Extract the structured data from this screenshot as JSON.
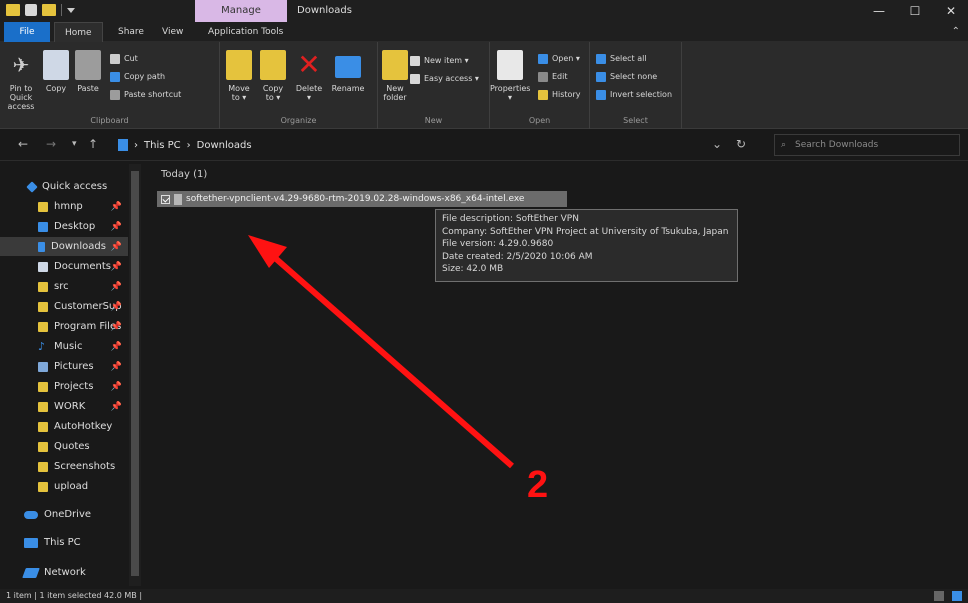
{
  "titlebar": {
    "manage_tab": "Manage",
    "title": "Downloads",
    "minimize": "—",
    "maximize": "☐",
    "close": "✕"
  },
  "tabs": [
    {
      "label": "File"
    },
    {
      "label": "Home"
    },
    {
      "label": "Share"
    },
    {
      "label": "View"
    },
    {
      "label": "Application Tools"
    }
  ],
  "ribbon": {
    "clipboard": {
      "label": "Clipboard",
      "pin": "Pin to Quick access",
      "copy": "Copy",
      "paste": "Paste",
      "cut": "Cut",
      "copy_path": "Copy path",
      "paste_shortcut": "Paste shortcut"
    },
    "organize": {
      "label": "Organize",
      "move_to": "Move to ▾",
      "copy_to": "Copy to ▾",
      "delete": "Delete ▾",
      "rename": "Rename"
    },
    "new": {
      "label": "New",
      "new_folder": "New folder",
      "new_item": "New item ▾",
      "easy_access": "Easy access ▾"
    },
    "open": {
      "label": "Open",
      "properties": "Properties ▾",
      "open": "Open ▾",
      "edit": "Edit",
      "history": "History"
    },
    "select": {
      "label": "Select",
      "select_all": "Select all",
      "select_none": "Select none",
      "invert": "Invert selection"
    }
  },
  "address": {
    "back": "←",
    "forward": "→",
    "recent": "▾",
    "up": "↑",
    "crumbs": [
      "This PC",
      "Downloads"
    ],
    "sep": "›",
    "refresh": "↻",
    "dropdown": "⌄",
    "search_placeholder": "Search Downloads"
  },
  "sidebar": {
    "items": [
      {
        "label": "Quick access",
        "pinned": false
      },
      {
        "label": "hmnp",
        "pinned": true
      },
      {
        "label": "Desktop",
        "pinned": true
      },
      {
        "label": "Downloads",
        "pinned": true
      },
      {
        "label": "Documents",
        "pinned": true
      },
      {
        "label": "src",
        "pinned": true
      },
      {
        "label": "CustomerSup",
        "pinned": true
      },
      {
        "label": "Program Files",
        "pinned": true
      },
      {
        "label": "Music",
        "pinned": true
      },
      {
        "label": "Pictures",
        "pinned": true
      },
      {
        "label": "Projects",
        "pinned": true
      },
      {
        "label": "WORK",
        "pinned": true
      },
      {
        "label": "AutoHotkey",
        "pinned": false
      },
      {
        "label": "Quotes",
        "pinned": false
      },
      {
        "label": "Screenshots",
        "pinned": false
      },
      {
        "label": "upload",
        "pinned": false
      },
      {
        "label": "OneDrive",
        "pinned": false
      },
      {
        "label": "This PC",
        "pinned": false
      },
      {
        "label": "Network",
        "pinned": false
      }
    ],
    "pin_glyph": "📌"
  },
  "content": {
    "group_header": "Today (1)",
    "file_name": "softether-vpnclient-v4.29-9680-rtm-2019.02.28-windows-x86_x64-intel.exe",
    "tooltip": [
      "File description: SoftEther VPN",
      "Company: SoftEther VPN Project at University of Tsukuba, Japan",
      "File version: 4.29.0.9680",
      "Date created: 2/5/2020 10:06 AM",
      "Size: 42.0 MB"
    ]
  },
  "statusbar": {
    "text": "1 item   |   1 item selected  42.0 MB   |"
  },
  "annotation": {
    "label": "2",
    "color": "#ff1212"
  },
  "colors": {
    "accent": "#1a6fc9",
    "manage_tab": "#d9b8e6",
    "folder": "#e5c33d",
    "selected_row": "#6b6b6b"
  }
}
